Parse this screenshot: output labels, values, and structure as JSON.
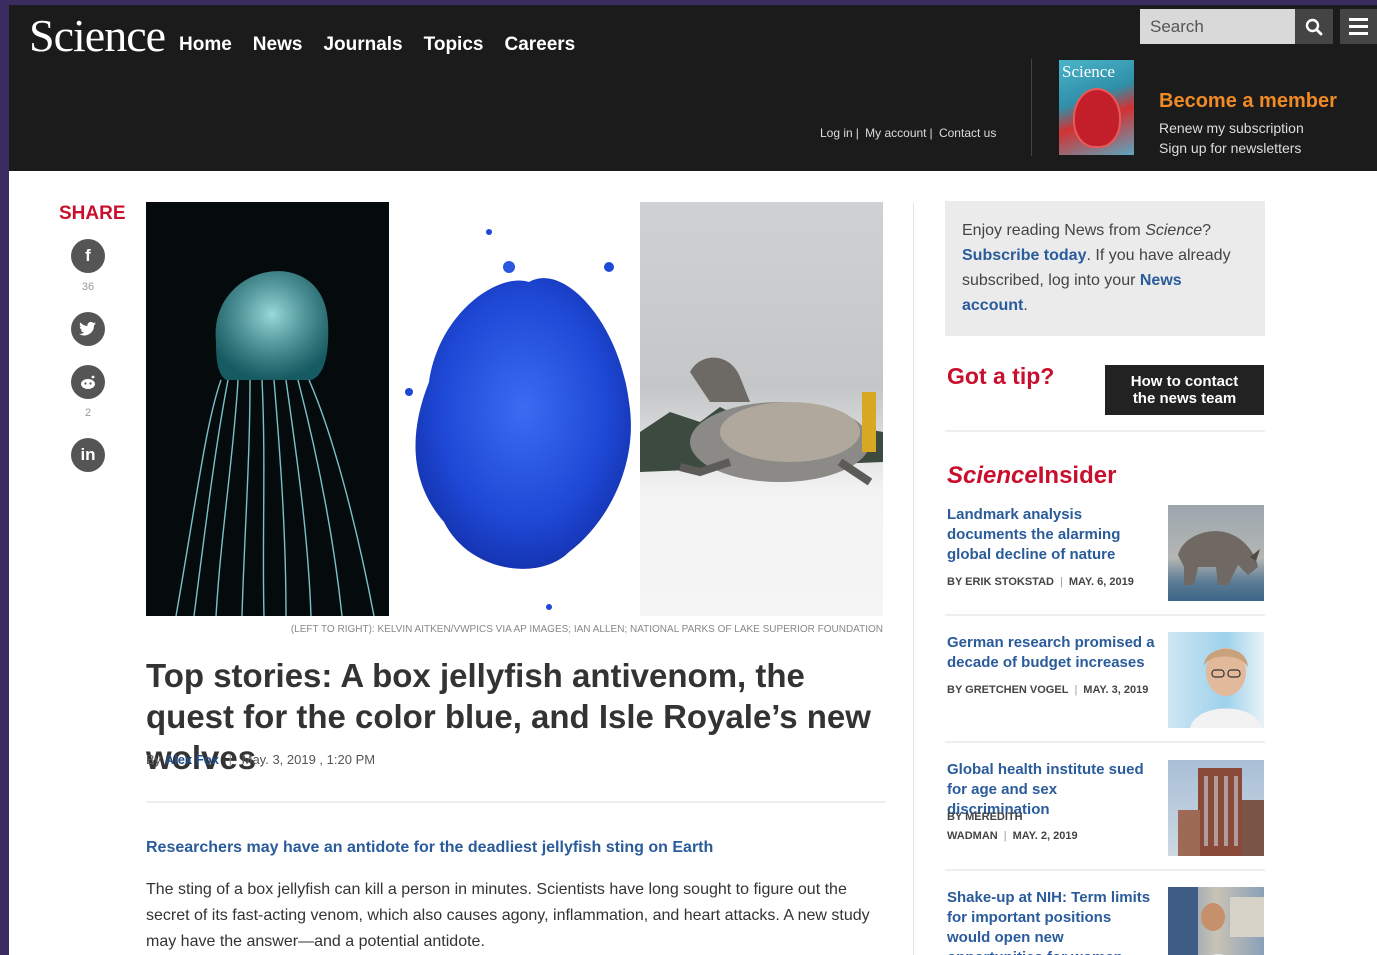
{
  "header": {
    "logo": "Science",
    "nav": [
      "Home",
      "News",
      "Journals",
      "Topics",
      "Careers"
    ],
    "search_placeholder": "Search",
    "account_links": [
      "Log in",
      "My account",
      "Contact us"
    ],
    "member_title": "Become a member",
    "renew": "Renew my subscription",
    "newsletters": "Sign up for newsletters",
    "cover_title": "Science"
  },
  "share": {
    "title": "SHARE",
    "facebook_count": "36",
    "reddit_count": "2"
  },
  "article": {
    "caption": "(LEFT TO RIGHT): KELVIN AITKEN/VWPICS VIA AP IMAGES; IAN ALLEN; NATIONAL PARKS OF LAKE SUPERIOR FOUNDATION",
    "headline": "Top stories: A box jellyfish antivenom, the quest for the color blue, and Isle Royale’s new wolves",
    "by": "By",
    "author": "Alex Fox",
    "date": "May. 3, 2019 , 1:20 PM",
    "subhead": "Researchers may have an antidote for the deadliest jellyfish sting on Earth",
    "body": "The sting of a box jellyfish can kill a person in minutes. Scientists have long sought to figure out the secret of its fast-acting venom, which also causes agony, inflammation, and heart attacks. A new study may have the answer—and a potential antidote."
  },
  "sidebar": {
    "promo_1": "Enjoy reading News from ",
    "promo_science": "Science",
    "promo_2": "? ",
    "promo_subscribe": "Subscribe today",
    "promo_3": ". If you have already subscribed, log into your ",
    "promo_news_account": "News account",
    "promo_4": ".",
    "tip_title": "Got a tip?",
    "contact_line1": "How to contact",
    "contact_line2": "the news team",
    "insider_a": "Science",
    "insider_b": "Insider",
    "stories": [
      {
        "title": "Landmark analysis documents the alarming global decline of nature",
        "author": "BY ERIK STOKSTAD",
        "date": "MAY. 6, 2019"
      },
      {
        "title": "German research promised a decade of budget increases",
        "author": "BY GRETCHEN VOGEL",
        "date": "MAY. 3, 2019"
      },
      {
        "title": "Global health institute sued for age and sex discrimination",
        "author_line1": "BY MEREDITH",
        "author_line2": "WADMAN",
        "date": "MAY. 2, 2019"
      },
      {
        "title": "Shake-up at NIH: Term limits for important positions would open new opportunities for women, minorities"
      }
    ]
  }
}
